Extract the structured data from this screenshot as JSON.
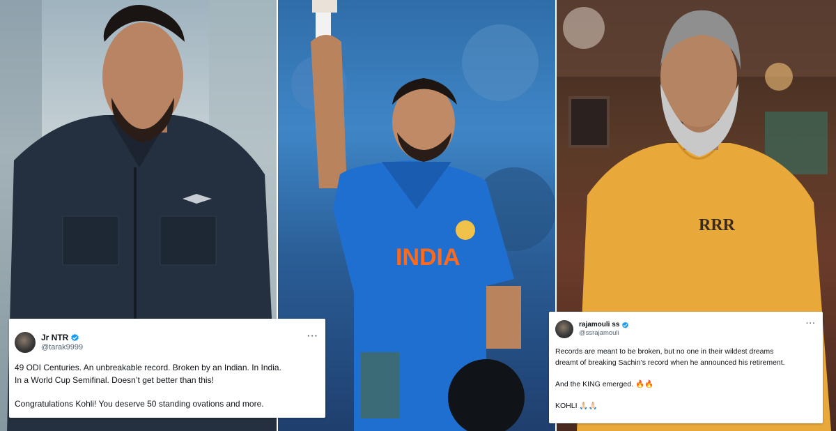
{
  "tweets": [
    {
      "display_name": "Jr NTR",
      "handle": "@tarak9999",
      "verified": true,
      "lines": [
        "49 ODI Centuries. An unbreakable record. Broken by an Indian. In India.",
        "In a World Cup Semifinal. Doesn’t get better than this!",
        "Congratulations Kohli! You deserve 50 standing ovations and more."
      ]
    },
    {
      "display_name": "rajamouli ss",
      "handle": "@ssrajamouli",
      "verified": true,
      "lines": [
        "Records are meant to be broken, but no one in their wildest dreams",
        "dreamt of breaking Sachin’s record when he announced his retirement.",
        "And the KING emerged. 🔥🔥",
        "KOHLI 🙏🏻🙏🏻"
      ]
    }
  ],
  "jersey": {
    "text": "INDIA",
    "patch": "RRR"
  },
  "more_glyph": "···",
  "colors": {
    "verified": "#1d9bf0",
    "jersey_blue": "#1f6fd1",
    "jersey_text": "#ff6a1a",
    "kurta": "#e9a93a"
  },
  "icons": [
    "verified-badge-icon",
    "more-options-icon",
    "avatar"
  ]
}
